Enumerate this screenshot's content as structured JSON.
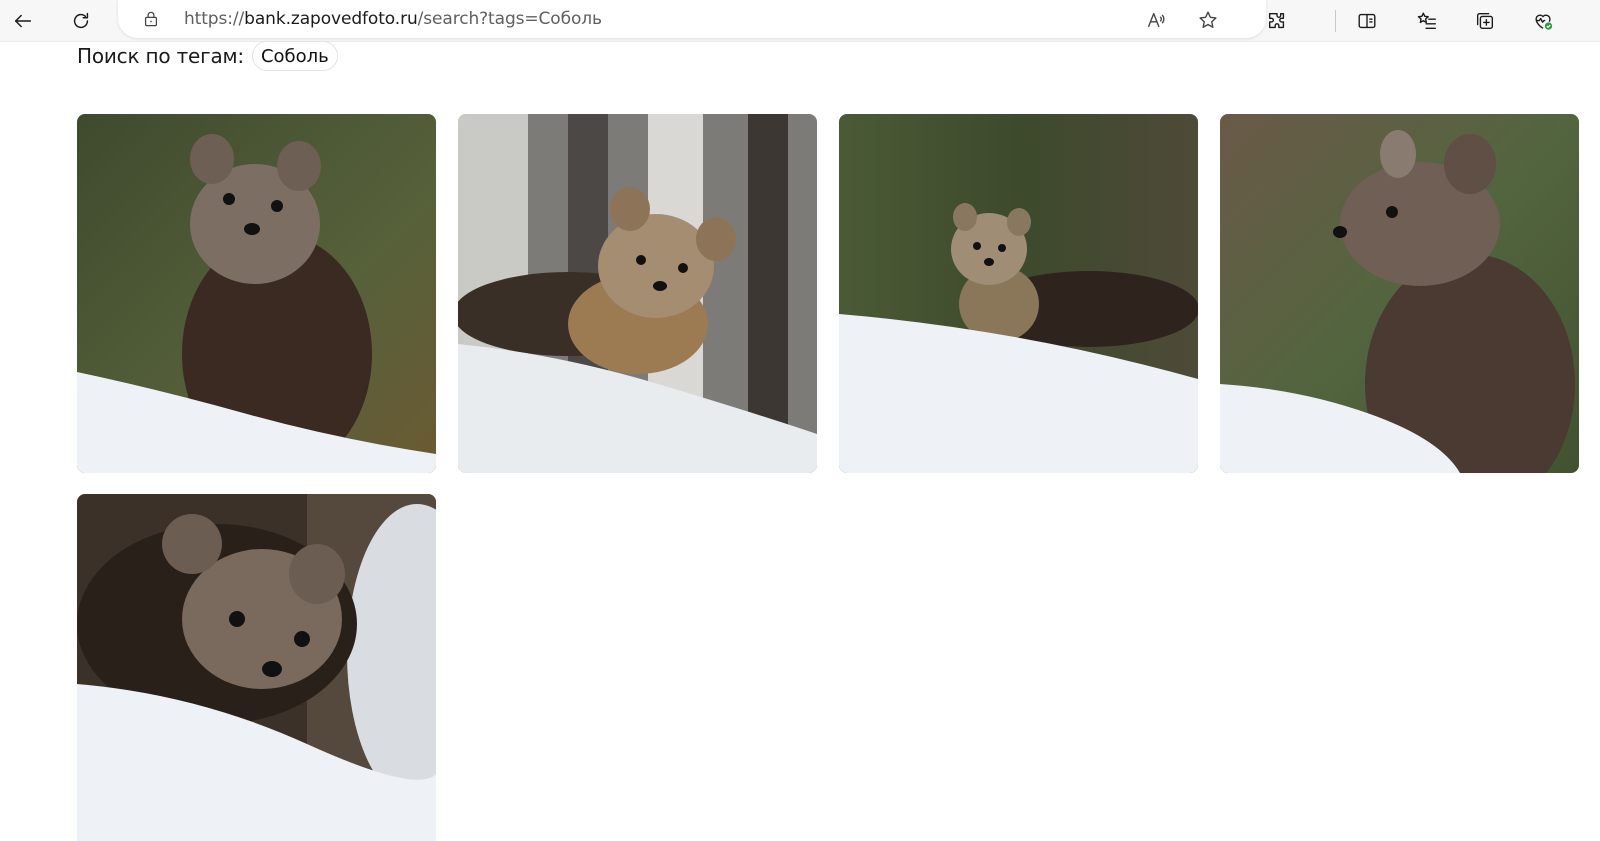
{
  "browser": {
    "url_prefix": "https://",
    "url_host": "bank.zapovedfoto.ru",
    "url_path": "/search?tags=Соболь",
    "icons": {
      "back": "back-arrow-icon",
      "reload": "reload-icon",
      "lock": "lock-icon",
      "read_aloud": "read-aloud-icon",
      "favorite": "star-icon",
      "extensions": "puzzle-icon",
      "split_screen": "split-screen-icon",
      "favorites_bar": "favorites-list-icon",
      "collections": "collections-icon",
      "health": "browser-health-icon"
    }
  },
  "search": {
    "label": "Поиск по тегам:",
    "tag": "Соболь"
  },
  "gallery": {
    "photos": [
      {
        "subject": "sable-photo",
        "bg": "#4c5a3a",
        "snow": "#eef2f6"
      },
      {
        "subject": "sable-photo",
        "bg": "#8a8a88",
        "snow": "#e8ecef"
      },
      {
        "subject": "sable-photo",
        "bg": "#4a5638",
        "snow": "#eef1f5"
      },
      {
        "subject": "sable-photo",
        "bg": "#5a6a45",
        "snow": "#eef2f7"
      },
      {
        "subject": "sable-photo",
        "bg": "#3a2e26",
        "snow": "#eef2f6"
      }
    ]
  },
  "colors": {
    "toolbar_bg": "#f7f7f7",
    "accent_green": "#2e9d3f"
  }
}
